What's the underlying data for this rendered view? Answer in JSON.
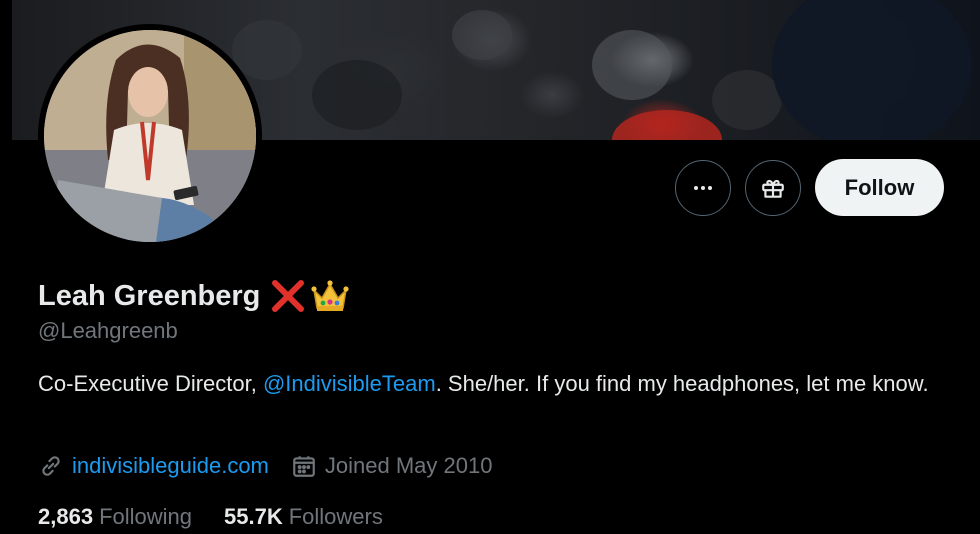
{
  "profile": {
    "display_name": "Leah Greenberg",
    "handle": "@Leahgreenb",
    "bio_prefix": "Co-Executive Director, ",
    "bio_mention": "@IndivisibleTeam",
    "bio_suffix": ". She/her. If you find my headphones, let me know.",
    "website": "indivisibleguide.com",
    "joined": "Joined May 2010",
    "following_count": "2,863",
    "following_label": "Following",
    "followers_count": "55.7K",
    "followers_label": "Followers"
  },
  "actions": {
    "follow_label": "Follow"
  },
  "icons": {
    "more": "more-dots-icon",
    "gift": "gift-icon",
    "link": "link-icon",
    "calendar": "calendar-icon",
    "red_x": "red-x-emoji-icon",
    "crown": "crown-emoji-icon"
  },
  "colors": {
    "background": "#000000",
    "text_primary": "#e7e9ea",
    "text_secondary": "#71767b",
    "accent": "#1d9bf0",
    "follow_button_bg": "#eff3f4"
  }
}
